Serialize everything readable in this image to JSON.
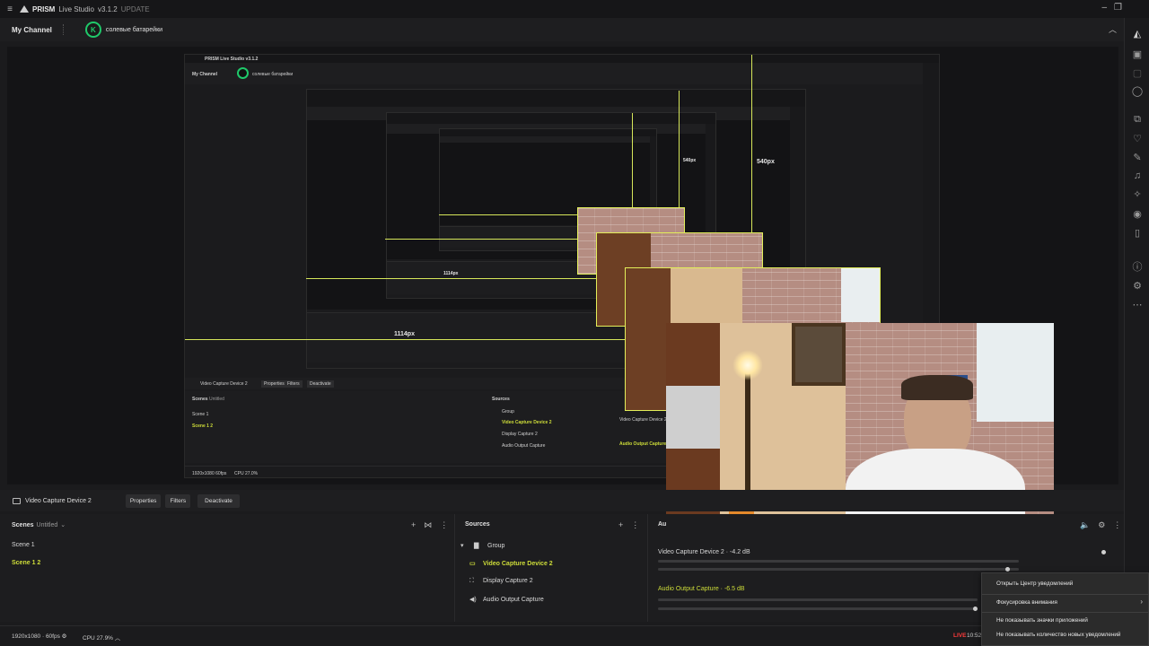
{
  "titlebar": {
    "app_name": "PRISM",
    "app_suffix": "Live Studio",
    "version": "v3.1.2",
    "update_label": "UPDATE"
  },
  "channel": {
    "my_channel": "My Channel",
    "avatar_letter": "K",
    "channel_name": "солевые батарейки"
  },
  "preview": {
    "guide_labels": [
      "540px",
      "1114px",
      "1114px",
      "540px"
    ],
    "inner_channel": "My Channel",
    "inner_channel_name": "солевые батарейки",
    "inner_app": "PRISM Live Studio v3.1.2",
    "inner_source": "Video Capture Device 2",
    "inner_buttons": [
      "Properties",
      "Filters",
      "Deactivate"
    ],
    "inner_scenes_title": "Scenes",
    "inner_scenes_sub": "Untitled",
    "inner_scenes": [
      "Scene 1",
      "Scene 1 2"
    ],
    "inner_sources_title": "Sources",
    "inner_sources": [
      "Group",
      "Video Capture Device 2",
      "Display Capture 2",
      "Audio Output Capture"
    ],
    "inner_status": "1920x1080  60fps",
    "inner_cpu": "CPU 27.0%",
    "inner_mixer": [
      "Video Capture Device 2",
      "Audio Output Capture"
    ]
  },
  "source_toolbar": {
    "source_name": "Video Capture Device 2",
    "properties": "Properties",
    "filters": "Filters",
    "deactivate": "Deactivate"
  },
  "scenes": {
    "title": "Scenes",
    "collection": "Untitled",
    "items": [
      {
        "label": "Scene 1",
        "selected": false
      },
      {
        "label": "Scene 1 2",
        "selected": true
      }
    ]
  },
  "sources": {
    "title": "Sources",
    "items": [
      {
        "label": "Group",
        "icon": "folder-icon",
        "selected": false
      },
      {
        "label": "Video Capture Device 2",
        "icon": "camera-icon",
        "selected": true
      },
      {
        "label": "Display Capture 2",
        "icon": "display-icon",
        "selected": false
      },
      {
        "label": "Audio Output Capture",
        "icon": "speaker-icon",
        "selected": false
      }
    ]
  },
  "mixer": {
    "title": "Au",
    "channels": [
      {
        "label": "Video Capture Device 2",
        "level": "-4.2 dB"
      },
      {
        "label": "Audio Output Capture",
        "level": "-6.5 dB"
      }
    ]
  },
  "statusbar": {
    "resolution": "1920x1080 · 60fps",
    "cpu": "CPU 27.9%",
    "live": "LIVE",
    "time": "10:52"
  },
  "context_menu": {
    "items": [
      "Открыть Центр уведомлений",
      "Фокусировка внимания",
      "Не показывать значки приложений",
      "Не показывать количество новых уведомлений"
    ]
  },
  "colors": {
    "accent_green": "#1fc96a",
    "selected_yellow": "#cddc39",
    "guide_yellow": "#d6e65a",
    "live_red": "#ff3b3b"
  }
}
